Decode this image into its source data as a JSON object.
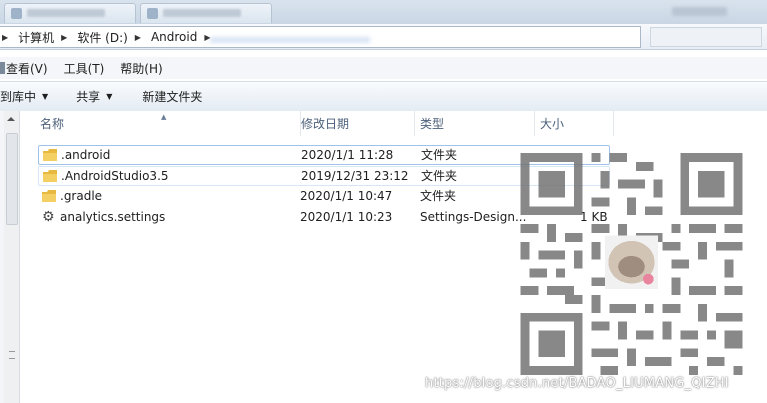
{
  "address": {
    "crumbs": [
      "计算机",
      "软件 (D:)",
      "Android"
    ]
  },
  "menu": {
    "items": [
      "查看(V)",
      "工具(T)",
      "帮助(H)"
    ]
  },
  "toolbar": {
    "include_label": "含到库中",
    "share_label": "共享",
    "new_folder_label": "新建文件夹"
  },
  "columns": {
    "name": "名称",
    "modified": "修改日期",
    "type": "类型",
    "size": "大小"
  },
  "files": [
    {
      "name": ".android",
      "modified": "2020/1/1 11:28",
      "type": "文件夹",
      "size": "",
      "icon": "folder-icon"
    },
    {
      "name": ".AndroidStudio3.5",
      "modified": "2019/12/31 23:12",
      "type": "文件夹",
      "size": "",
      "icon": "folder-icon"
    },
    {
      "name": ".gradle",
      "modified": "2020/1/1 10:47",
      "type": "文件夹",
      "size": "",
      "icon": "folder-icon"
    },
    {
      "name": "analytics.settings",
      "modified": "2020/1/1 10:23",
      "type": "Settings-Design...",
      "size": "1 KB",
      "icon": "gear-icon"
    }
  ],
  "watermark": "https://blog.csdn.net/BADAO_LIUMANG_QIZHI",
  "colors": {
    "folder": "#e8b940",
    "selection_border": "#9ec3ea",
    "header_text": "#4c607a"
  }
}
